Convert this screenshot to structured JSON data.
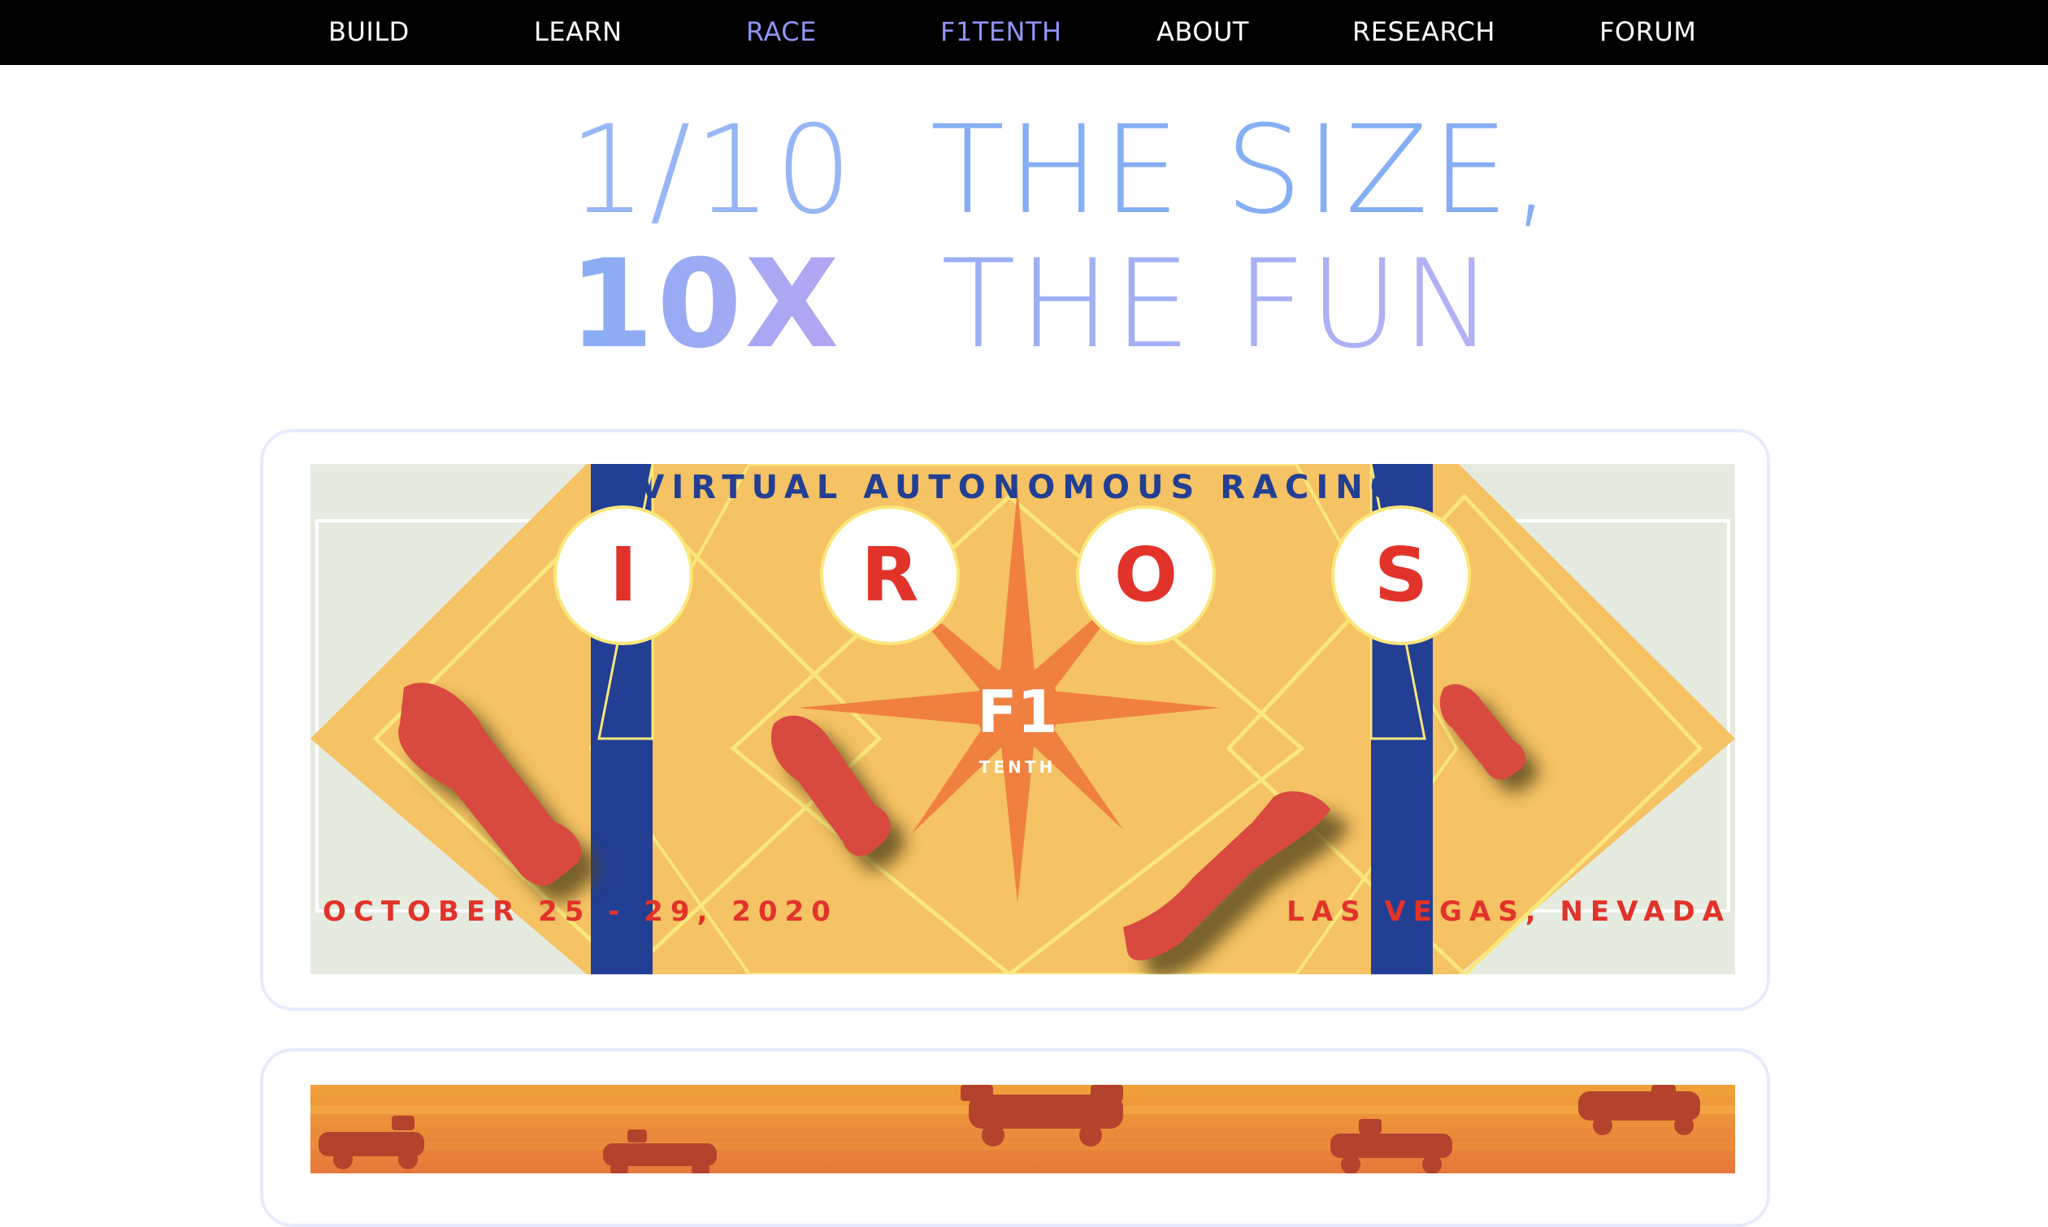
{
  "nav": {
    "items": [
      {
        "label": "BUILD",
        "active": false
      },
      {
        "label": "LEARN",
        "active": false
      },
      {
        "label": "RACE",
        "active": true
      },
      {
        "label": "F1TENTH",
        "active": true
      },
      {
        "label": "ABOUT",
        "active": false
      },
      {
        "label": "RESEARCH",
        "active": false
      },
      {
        "label": "FORUM",
        "active": false
      }
    ]
  },
  "hero": {
    "line1_fraction": "1/10",
    "line1_rest": "THE SIZE,",
    "line2_strong": "10X",
    "line2_rest": "THE FUN"
  },
  "iros_banner": {
    "title": "VIRTUAL AUTONOMOUS RACING",
    "letters": [
      "I",
      "R",
      "O",
      "S"
    ],
    "logo_main": "F1",
    "logo_sub": "TENTH",
    "date": "OCTOBER 25 - 29, 2020",
    "location": "LAS VEGAS, NEVADA"
  },
  "colors": {
    "nav_bg": "#000000",
    "nav_text": "#ffffff",
    "nav_active": "#8f95f3",
    "hero_blue": "#86aef5",
    "hero_lavender": "#b3b2f4",
    "banner_yellow": "#f5c264",
    "banner_blue": "#223f94",
    "banner_red": "#e2332b",
    "banner_orange": "#ef8040",
    "banner_grass": "#e6ebdf"
  }
}
